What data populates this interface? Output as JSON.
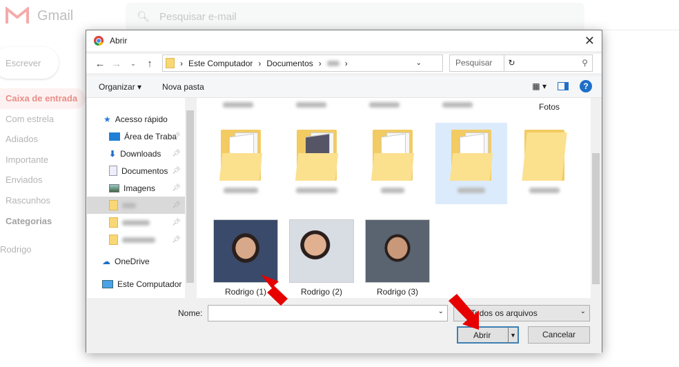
{
  "gmail": {
    "logo": "Gmail",
    "search_placeholder": "Pesquisar e-mail",
    "compose": "Escrever",
    "nav": [
      "Caixa de entrada",
      "Com estrela",
      "Adiados",
      "Importante",
      "Enviados",
      "Rascunhos",
      "Categorias"
    ],
    "account": "Rodrigo"
  },
  "dialog": {
    "title": "Abrir",
    "path": [
      "Este Computador",
      "Documentos"
    ],
    "search_placeholder": "Pesquisar",
    "toolbar": {
      "organize": "Organizar",
      "new_folder": "Nova pasta"
    },
    "nav_pane": {
      "quick_access": "Acesso rápido",
      "items": [
        "Área de Traba",
        "Downloads",
        "Documentos",
        "Imagens"
      ],
      "onedrive": "OneDrive",
      "this_pc": "Este Computador"
    },
    "folders": {
      "top_label": "Fotos"
    },
    "photos": [
      "Rodrigo (1)",
      "Rodrigo (2)",
      "Rodrigo (3)"
    ],
    "name_label": "Nome:",
    "name_value": "",
    "filter": "Todos os arquivos",
    "open": "Abrir",
    "cancel": "Cancelar"
  },
  "colors": {
    "arrow": "#e60000",
    "accent": "#1e6fc8"
  }
}
